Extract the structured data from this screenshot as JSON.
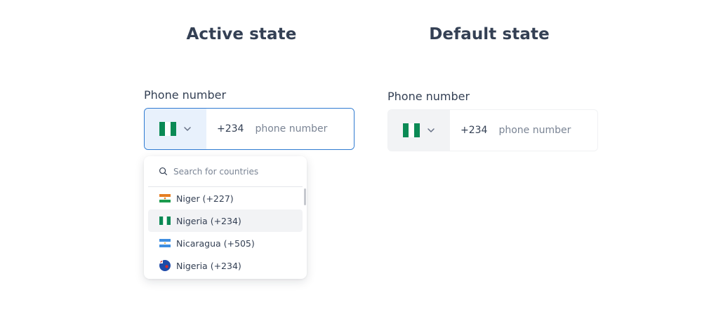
{
  "headings": {
    "active": "Active state",
    "default": "Default state"
  },
  "active_field": {
    "label": "Phone number",
    "flag_icon": "nigeria-flag-icon",
    "dial_code": "+234",
    "placeholder": "phone number",
    "border_color": "#2e7ad1",
    "country_bg": "#e8f1fc"
  },
  "default_field": {
    "label": "Phone number",
    "flag_icon": "nigeria-flag-icon",
    "dial_code": "+234",
    "placeholder": "phone number",
    "country_bg": "#f2f3f5"
  },
  "dropdown": {
    "search_placeholder": "Search for countries",
    "items": [
      {
        "label": "Niger (+227)",
        "flag": "niger-flag-icon",
        "selected": false
      },
      {
        "label": "Nigeria (+234)",
        "flag": "nigeria-flag-icon",
        "selected": true
      },
      {
        "label": "Nicaragua (+505)",
        "flag": "nicaragua-flag-icon",
        "selected": false
      },
      {
        "label": "Nigeria (+234)",
        "flag": "round-flag-icon",
        "selected": false
      }
    ]
  },
  "colors": {
    "text": "#344054",
    "placeholder": "#7a8494",
    "nigeria_green": "#0b8a55",
    "accent": "#2e7ad1"
  }
}
